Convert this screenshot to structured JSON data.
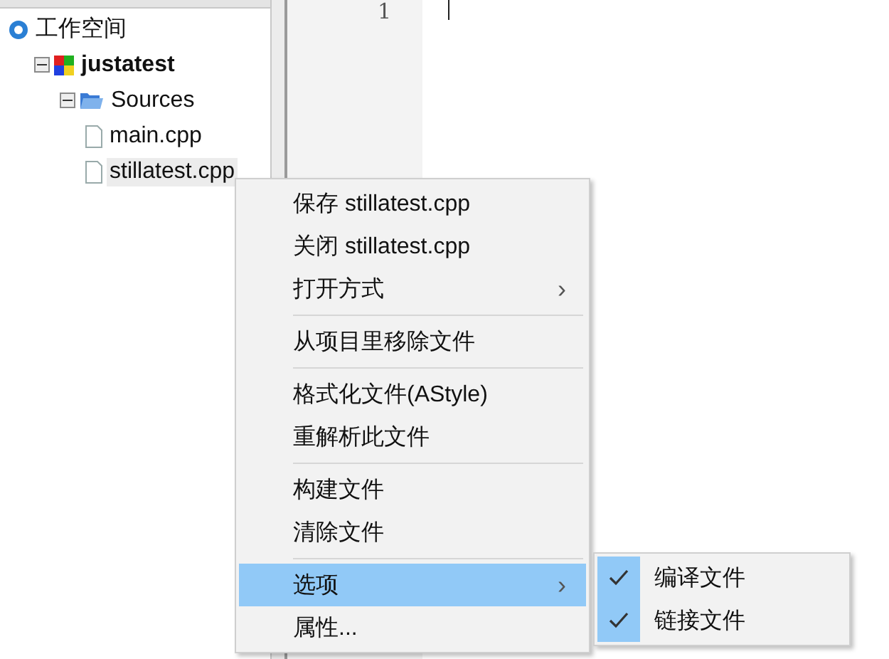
{
  "tree": [
    {
      "label": "工作空间",
      "kind": "workspace",
      "selected": false,
      "children": [
        {
          "label": "justatest",
          "kind": "project",
          "selected": false,
          "expanded": true,
          "children": [
            {
              "label": "Sources",
              "kind": "folder",
              "selected": false,
              "expanded": true,
              "children": [
                {
                  "label": "main.cpp",
                  "kind": "file",
                  "selected": false
                },
                {
                  "label": "stillatest.cpp",
                  "kind": "file",
                  "selected": true
                }
              ]
            }
          ]
        }
      ]
    }
  ],
  "editor": {
    "line_numbers": [
      "1"
    ]
  },
  "context_menu": {
    "items": [
      {
        "kind": "item",
        "label": "保存 stillatest.cpp",
        "selected": false
      },
      {
        "kind": "item",
        "label": "关闭 stillatest.cpp",
        "selected": false
      },
      {
        "kind": "item",
        "label": "打开方式",
        "arrow": "›",
        "selected": false
      },
      {
        "kind": "separator"
      },
      {
        "kind": "item",
        "label": "从项目里移除文件",
        "selected": false
      },
      {
        "kind": "separator"
      },
      {
        "kind": "item",
        "label": "格式化文件(AStyle)",
        "selected": false
      },
      {
        "kind": "item",
        "label": "重解析此文件",
        "selected": false
      },
      {
        "kind": "separator"
      },
      {
        "kind": "item",
        "label": "构建文件",
        "selected": false
      },
      {
        "kind": "item",
        "label": "清除文件",
        "selected": false
      },
      {
        "kind": "separator"
      },
      {
        "kind": "item",
        "label": "选项",
        "arrow": "›",
        "selected": true
      },
      {
        "kind": "item",
        "label": "属性...",
        "selected": false
      }
    ],
    "submenu": {
      "items": [
        {
          "label": "编译文件",
          "checked": true
        },
        {
          "label": "链接文件",
          "checked": true
        }
      ]
    }
  }
}
